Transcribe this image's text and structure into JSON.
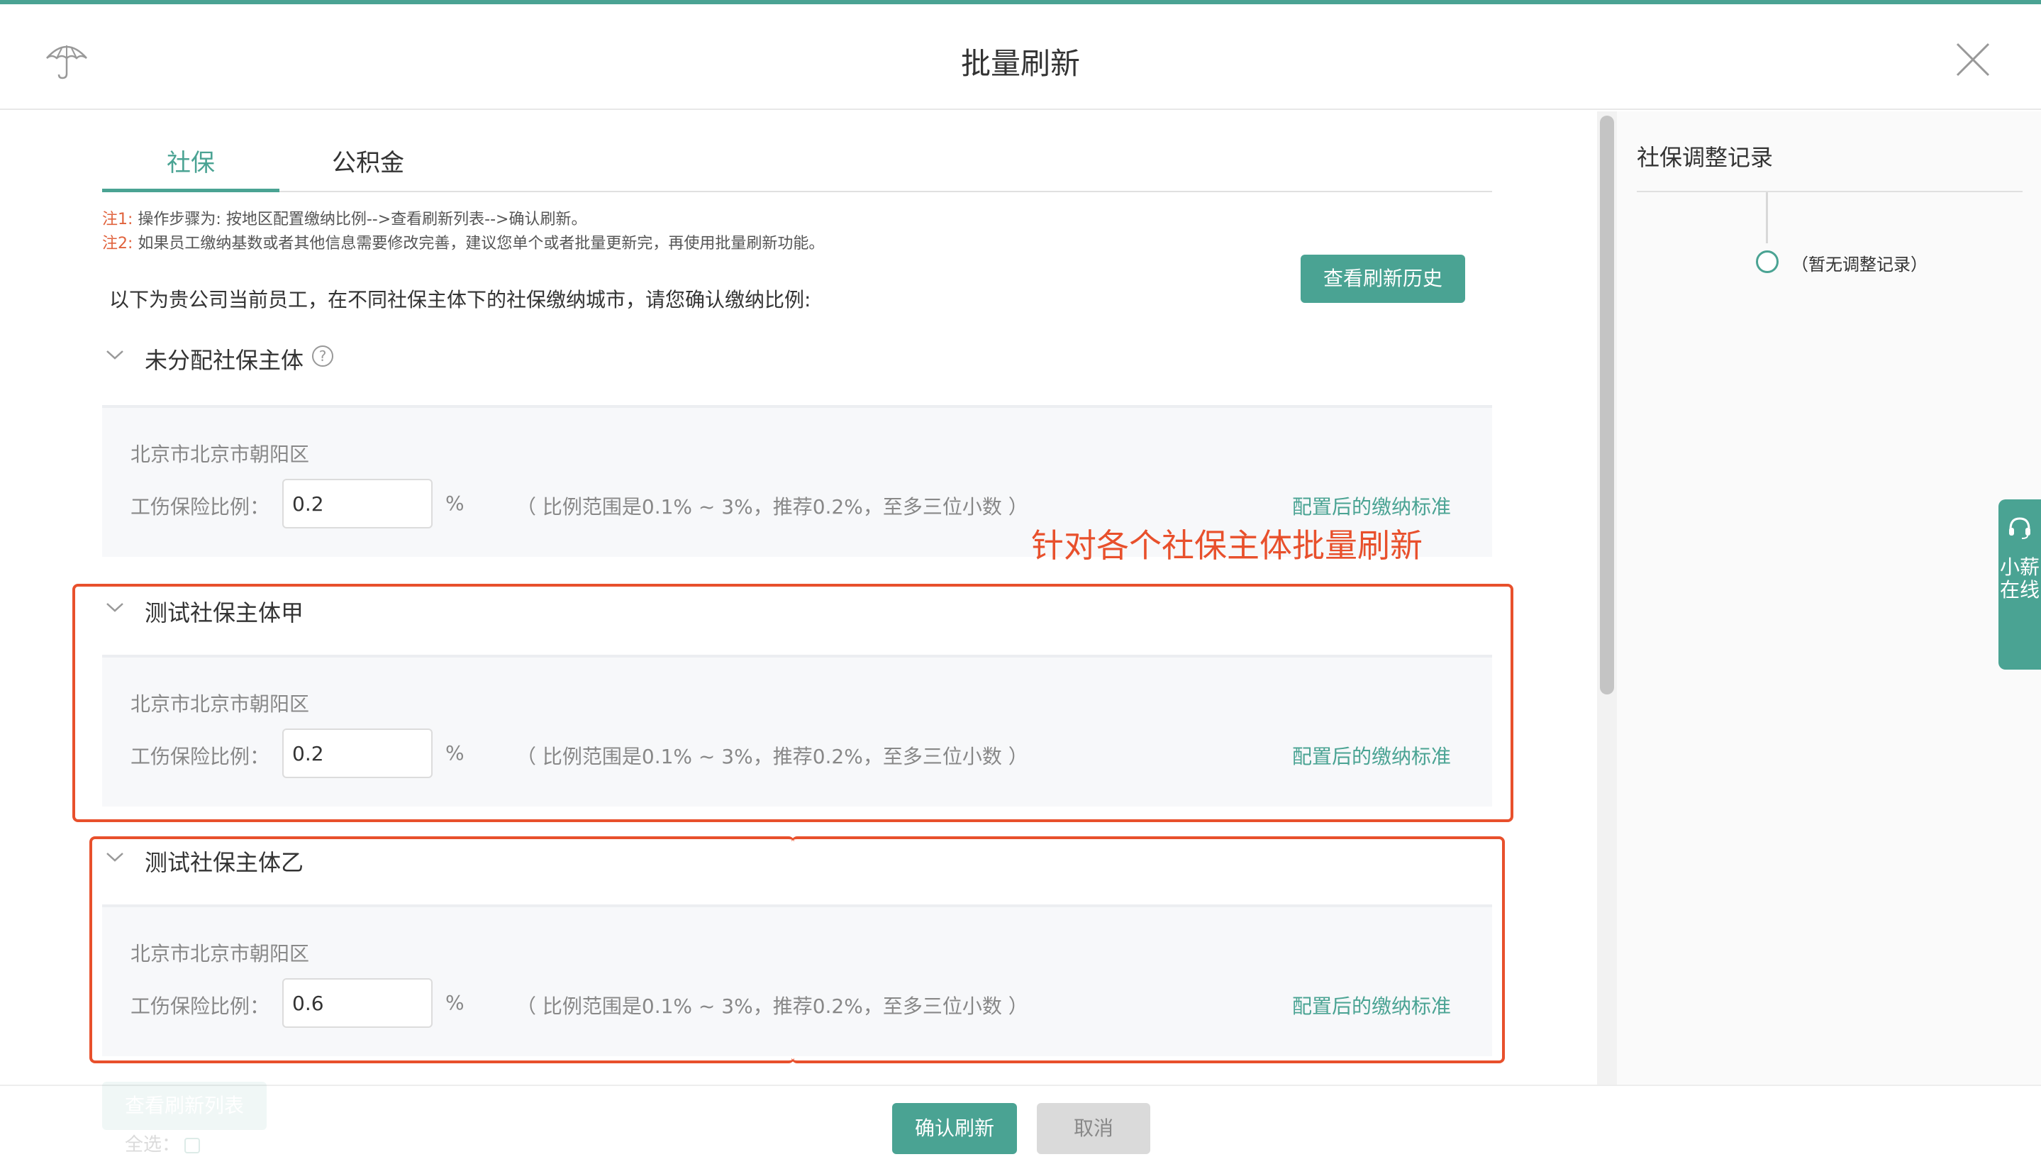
{
  "header": {
    "title": "批量刷新"
  },
  "tabs": [
    {
      "label": "社保"
    },
    {
      "label": "公积金"
    }
  ],
  "notes": [
    {
      "key": "注1:",
      "text": " 操作步骤为: 按地区配置缴纳比例-->查看刷新列表-->确认刷新。"
    },
    {
      "key": "注2:",
      "text": " 如果员工缴纳基数或者其他信息需要修改完善，建议您单个或者批量更新完，再使用批量刷新功能。"
    }
  ],
  "history_button": "查看刷新历史",
  "intro": "以下为贵公司当前员工，在不同社保主体下的社保缴纳城市，请您确认缴纳比例:",
  "groups": [
    {
      "title": "未分配社保主体",
      "city": "北京市北京市朝阳区",
      "ratio_label": "工伤保险比例：",
      "ratio_value": "0.2",
      "unit": "%",
      "hint": "（ 比例范围是0.1% ~ 3%，推荐0.2%，至多三位小数 ）",
      "link": "配置后的缴纳标准"
    },
    {
      "title": "测试社保主体甲",
      "city": "北京市北京市朝阳区",
      "ratio_label": "工伤保险比例：",
      "ratio_value": "0.2",
      "unit": "%",
      "hint": "（ 比例范围是0.1% ~ 3%，推荐0.2%，至多三位小数 ）",
      "link": "配置后的缴纳标准"
    },
    {
      "title": "测试社保主体乙",
      "city": "北京市北京市朝阳区",
      "ratio_label": "工伤保险比例：",
      "ratio_value": "0.6",
      "unit": "%",
      "hint": "（ 比例范围是0.1% ~ 3%，推荐0.2%，至多三位小数 ）",
      "link": "配置后的缴纳标准"
    }
  ],
  "annotation": "针对各个社保主体批量刷新",
  "side": {
    "title": "社保调整记录",
    "empty_text": "（暂无调整记录）"
  },
  "online_widget": "小薪在线",
  "footer": {
    "view_list": "查看刷新列表",
    "select_all": "全选：",
    "confirm": "确认刷新",
    "cancel": "取消"
  },
  "colors": {
    "accent": "#4aa393",
    "annotation": "#e8502c",
    "note_key": "#e0623c"
  }
}
